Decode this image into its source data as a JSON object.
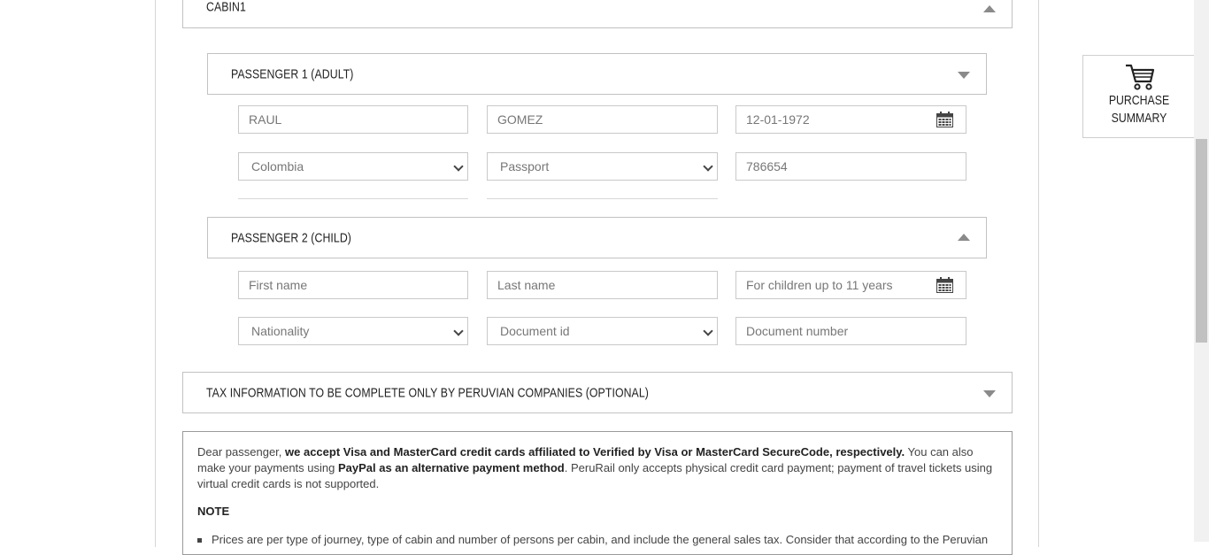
{
  "cabin": {
    "title": "CABIN1",
    "arrow": "up"
  },
  "passenger1": {
    "title": "PASSENGER 1 (ADULT)",
    "arrow": "down",
    "first_name": "RAUL",
    "last_name": "GOMEZ",
    "birth_date": "12-01-1972",
    "nationality": "Colombia",
    "document_type": "Passport",
    "document_number": "786654"
  },
  "passenger2": {
    "title": "PASSENGER 2 (CHILD)",
    "arrow": "up",
    "first_name_placeholder": "First name",
    "last_name_placeholder": "Last name",
    "birth_date_placeholder": "For children up to 11 years",
    "nationality_placeholder": "Nationality",
    "document_type_placeholder": "Document id",
    "document_number_placeholder": "Document number"
  },
  "tax": {
    "title": "TAX INFORMATION TO BE COMPLETE ONLY BY PERUVIAN COMPANIES (OPTIONAL)",
    "arrow": "down"
  },
  "payment_info": {
    "intro": "Dear passenger, ",
    "bold1": "we accept Visa and MasterCard credit cards affiliated to Verified by Visa or MasterCard SecureCode, respectively.",
    "text1": " You can also make your payments using ",
    "bold2": "PayPal as an alternative payment method",
    "text2": ". PeruRail only accepts physical credit card payment; payment of travel tickets using virtual credit cards is not supported.",
    "note_title": "NOTE",
    "bullet1": "Prices are per type of journey, type of cabin and number of persons per cabin, and include the general sales tax. Consider that according to the Peruvian"
  },
  "purchase_summary": {
    "line1": "PURCHASE",
    "line2": "SUMMARY",
    "icon": "cart-icon"
  },
  "colors": {
    "border": "#c2c2c2",
    "text": "#222222",
    "arrow": "#8a8a8a"
  }
}
